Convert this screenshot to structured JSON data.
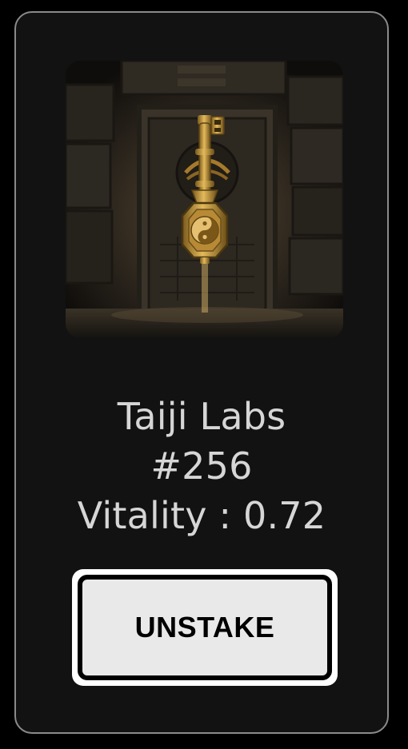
{
  "card": {
    "image_icon": "golden-key-nft-image",
    "name": "Taiji Labs",
    "token_id": "#256",
    "vitality_label": "Vitality : 0.72",
    "vitality_value": 0.72
  },
  "actions": {
    "unstake_label": "UNSTAKE"
  },
  "colors": {
    "page_background": "#000000",
    "card_background": "#121212",
    "card_border": "#8a8a8a",
    "text": "#d6d6d6",
    "button_face": "#e9e9e9",
    "button_outline": "#000000"
  }
}
